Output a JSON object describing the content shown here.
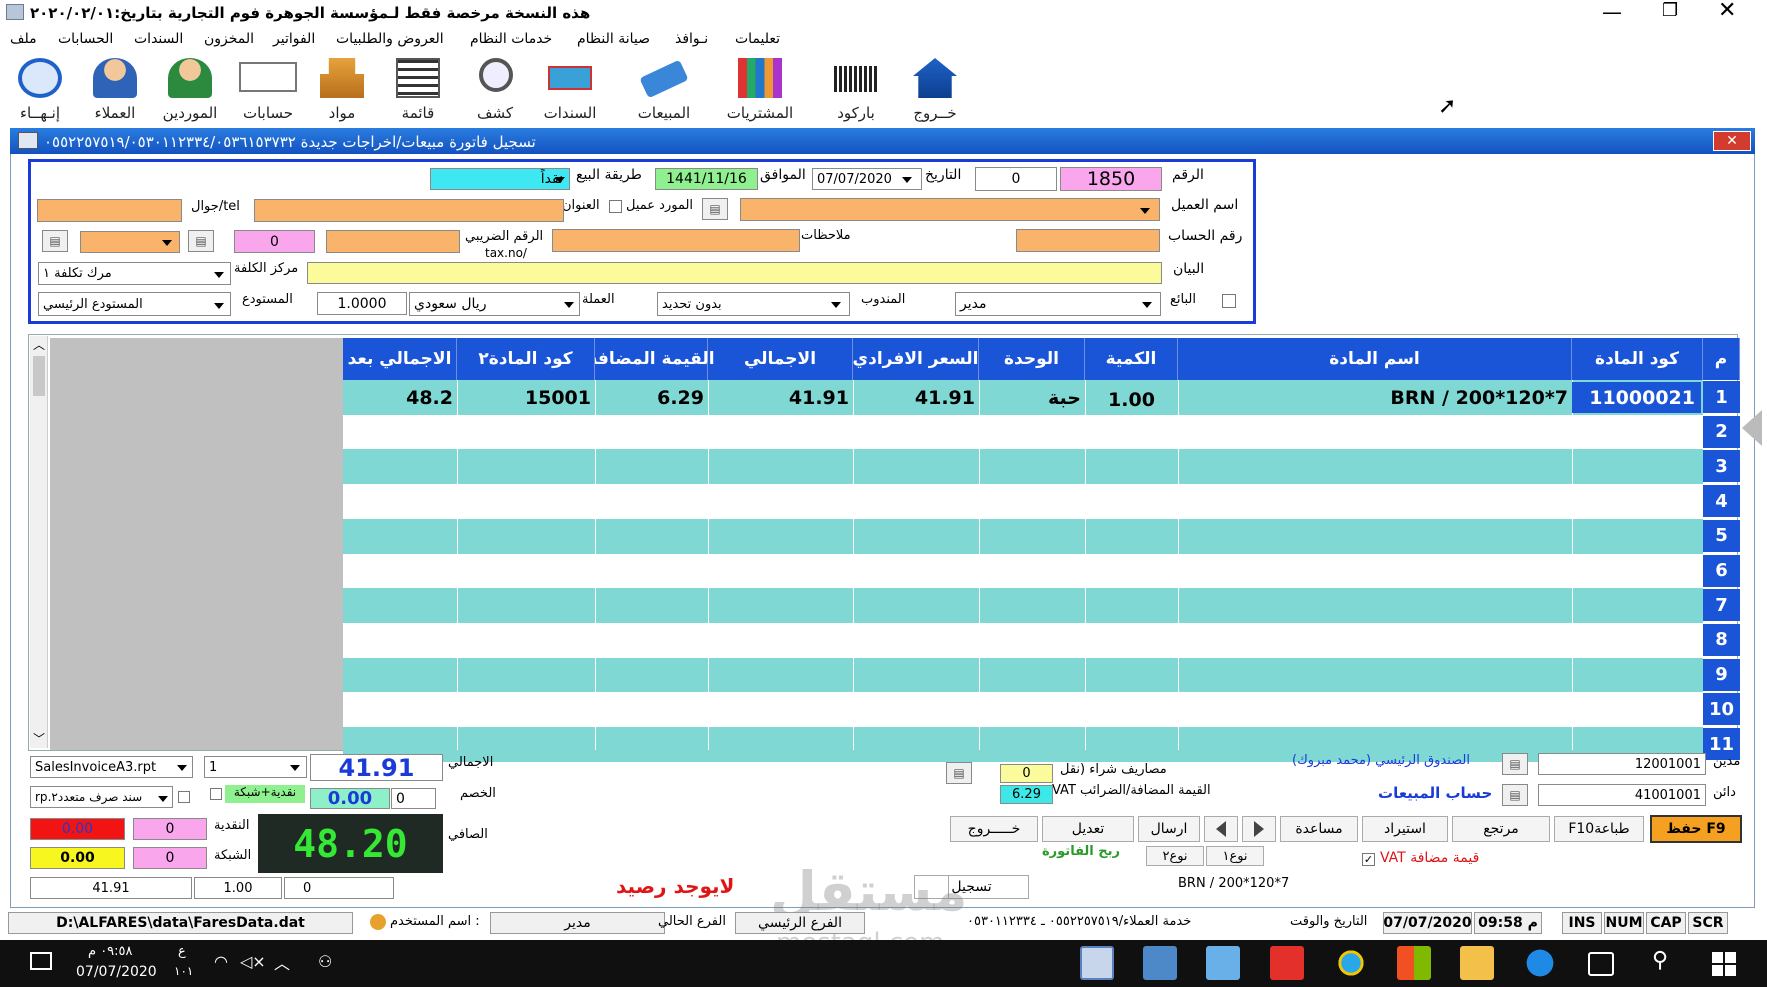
{
  "title_bar": {
    "title": "هذه النسخة مرخصة فقط لـمؤسسة الجوهرة فوم التجارية  بتاريخ:٢٠٢٠/٠٢/٠١"
  },
  "menu": [
    "تعليمات",
    "نـوافذ",
    "صيانة النظام",
    "خدمات النظام",
    "العروض والطلبيات",
    "الفواتير",
    "المخزون",
    "السندات",
    "الحسابات",
    "ملف"
  ],
  "toolbar": [
    "خــروج",
    "باركود",
    "المشتريات",
    "المبيعات",
    "السندات",
    "كشف",
    "قائمة",
    "مواد",
    "حسابات",
    "الموردين",
    "العملاء",
    "إنـهــاء"
  ],
  "window": {
    "title": "تسجيل فاتورة مبيعات/اخراجات جديدة ٠٥٥٢٢٥٧٥١٩/٠٥٣٠١١٢٣٣٤/٠٥٣٦١٥٣٧٣٢"
  },
  "form": {
    "number_label": "الرقم",
    "number": "1850",
    "number2": "0",
    "date_label": "التاريخ",
    "date": "07/07/2020",
    "hijri_label": "الموافق",
    "hijri": "1441/11/16",
    "sale_method_label": "طريقة البيع",
    "sale_method": "نقداً",
    "customer_label": "اسم العميل",
    "supplier_customer": "المورد عميل",
    "address_label": "العنوان",
    "mobile_label": "جوال/tel",
    "account_label": "رقم الحساب",
    "notes_label": "ملاحظات",
    "tax_label": "الرقم الضريبي",
    "tax_label2": "tax.no/",
    "cost_center_label": "مركز الكلفة",
    "cost_center": "مرك تكلفة ١",
    "statement_label": "البيان",
    "seller_label": "البائع",
    "seller": "مدير",
    "rep_label": "المندوب",
    "rep": "بدون تحديد",
    "currency_label": "العملة",
    "currency": "ريال سعودي",
    "rate": "1.0000",
    "warehouse_label": "المستودع",
    "warehouse": "المستودع الرئيسي",
    "pink_zero": "0"
  },
  "table": {
    "headers": [
      "م",
      "كود المادة",
      "اسم  المادة",
      "الكمية",
      "الوحدة",
      "السعر الافرادي",
      "الاجمالي",
      "القيمة المضافة",
      "كود المادة٢",
      "الاجمالي بعد"
    ],
    "rows": [
      {
        "n": "1",
        "code": "11000021",
        "name": "BRN / 200*120*7",
        "qty": "1.00",
        "unit": "حبة",
        "price": "41.91",
        "total": "41.91",
        "vat": "6.29",
        "code2": "15001",
        "after": "48.2"
      },
      {
        "n": "2"
      },
      {
        "n": "3"
      },
      {
        "n": "4"
      },
      {
        "n": "5"
      },
      {
        "n": "6"
      },
      {
        "n": "7"
      },
      {
        "n": "8"
      },
      {
        "n": "9"
      },
      {
        "n": "10"
      },
      {
        "n": "11"
      }
    ]
  },
  "footer": {
    "debit_label": "مدين",
    "debit_acc": "12001001",
    "debit_name": "الصندوق الرئيسي (محمد مبروك)",
    "credit_label": "دائن",
    "credit_acc": "41001001",
    "credit_name": "حساب المبيعات",
    "purchase_exp_label": "مصاريف شراء (نقل",
    "purchase_exp": "0",
    "vat_label": "VAT القيمة المضافة/الضرائب",
    "vat": "6.29",
    "total_label": "الاجمالي",
    "total": "41.91",
    "discount_label": "الخصم",
    "discount": "0.00",
    "discount_pct": "0",
    "net_label": "الصافي",
    "net": "48.20",
    "cash_label": "النقدية",
    "cash": "0",
    "card_label": "الشبكة",
    "card": "0",
    "red_box": "0.00",
    "yellow_box": "0.00",
    "cash_card": "نقدية+شبكة",
    "report": "SalesInvoiceA3.rpt",
    "copies": "1",
    "voucher": "سند صرف متعدد٢.rp",
    "bottom_vals": [
      "41.91",
      "1.00",
      "0"
    ],
    "no_balance": "لايوجد رصيد",
    "register": "تسجيل",
    "item_name": "BRN / 200*120*7",
    "invoice_profit": "ربح الفاتورة",
    "vat_check": "VAT قيمة مضافة",
    "buttons": [
      "حفظ F9",
      "F10طباعة",
      "مرتجع",
      "استيراد",
      "مساعدة",
      "ارسال",
      "تعديل",
      "خـــــروج"
    ],
    "type1": "نوع١",
    "type2": "نوع٢"
  },
  "status": {
    "path": "D:\\ALFARES\\data\\FaresData.dat",
    "user_label": "اسم المستخدم :",
    "user": "مدير",
    "branch_label": "الفرع الحالي",
    "branch": "الفرع الرئيسي",
    "service": "خدمة العملاء/٠٥٥٢٢٥٧٥١٩ ـ ٠٥٣٠١١٢٣٣٤",
    "dt_label": "التاريخ والوقت",
    "date": "07/07/2020",
    "time": "09:58 م",
    "keys": [
      "INS",
      "NUM",
      "CAP",
      "SCR"
    ]
  },
  "taskbar": {
    "time": "٠٩:٥٨ م",
    "date": "07/07/2020",
    "lang": "ع",
    "lang2": "١٠١"
  },
  "watermark": {
    "ar": "مستقل",
    "en": "mostaql.com"
  }
}
